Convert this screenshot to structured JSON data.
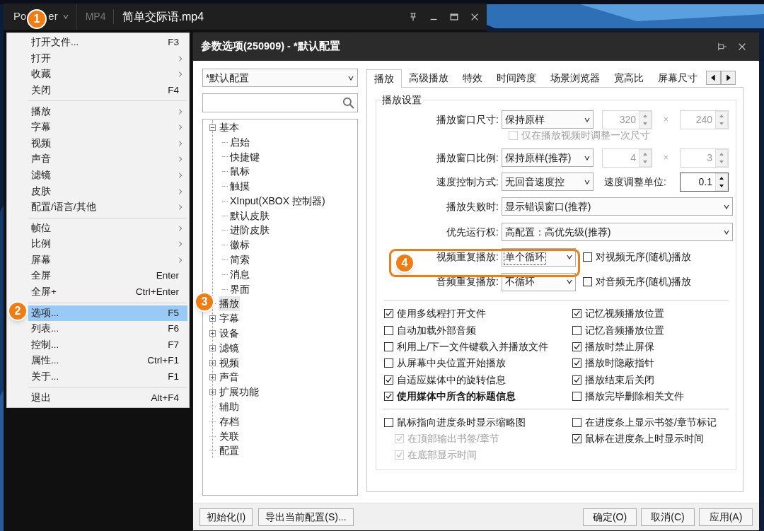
{
  "player": {
    "app_label_parts": [
      "Po",
      "er"
    ],
    "format": "MP4",
    "file": "简单交际语.mp4"
  },
  "badges": [
    "1",
    "2",
    "3",
    "4"
  ],
  "menu": {
    "groups": [
      [
        {
          "label": "打开文件...",
          "shortcut": "F3",
          "submenu": false,
          "selected": false
        },
        {
          "label": "打开",
          "submenu": true,
          "selected": false
        },
        {
          "label": "收藏",
          "submenu": true,
          "selected": false
        },
        {
          "label": "关闭",
          "shortcut": "F4",
          "submenu": false,
          "selected": false
        }
      ],
      [
        {
          "label": "播放",
          "submenu": true,
          "selected": false
        },
        {
          "label": "字幕",
          "submenu": true,
          "selected": false
        },
        {
          "label": "视频",
          "submenu": true,
          "selected": false
        },
        {
          "label": "声音",
          "submenu": true,
          "selected": false
        },
        {
          "label": "滤镜",
          "submenu": true,
          "selected": false
        },
        {
          "label": "皮肤",
          "submenu": true,
          "selected": false
        },
        {
          "label": "配置/语言/其他",
          "submenu": true,
          "selected": false
        }
      ],
      [
        {
          "label": "帧位",
          "submenu": true,
          "selected": false
        },
        {
          "label": "比例",
          "submenu": true,
          "selected": false
        },
        {
          "label": "屏幕",
          "submenu": true,
          "selected": false
        },
        {
          "label": "全屏",
          "shortcut": "Enter",
          "submenu": false,
          "selected": false
        },
        {
          "label": "全屏+",
          "shortcut": "Ctrl+Enter",
          "submenu": false,
          "selected": false
        }
      ],
      [
        {
          "label": "选项...",
          "shortcut": "F5",
          "submenu": false,
          "selected": true
        },
        {
          "label": "列表...",
          "shortcut": "F6",
          "submenu": false,
          "selected": false
        },
        {
          "label": "控制...",
          "shortcut": "F7",
          "submenu": false,
          "selected": false
        },
        {
          "label": "属性...",
          "shortcut": "Ctrl+F1",
          "submenu": false,
          "selected": false
        },
        {
          "label": "关于...",
          "shortcut": "F1",
          "submenu": false,
          "selected": false
        }
      ],
      [
        {
          "label": "退出",
          "shortcut": "Alt+F4",
          "submenu": false,
          "selected": false
        }
      ]
    ]
  },
  "dialog": {
    "title": "参数选项(250909) - *默认配置",
    "profile": "*默认配置",
    "tree": [
      {
        "label": "基本",
        "expanded": true,
        "selected": false,
        "children": [
          {
            "label": "启始",
            "selected": false
          },
          {
            "label": "快捷键",
            "selected": false
          },
          {
            "label": "鼠标",
            "selected": false
          },
          {
            "label": "触摸",
            "selected": false
          },
          {
            "label": "XInput(XBOX 控制器)",
            "selected": false
          },
          {
            "label": "默认皮肤",
            "selected": false
          },
          {
            "label": "进阶皮肤",
            "selected": false
          },
          {
            "label": "徽标",
            "selected": false
          },
          {
            "label": "简索",
            "selected": false
          },
          {
            "label": "消息",
            "selected": false
          },
          {
            "label": "界面",
            "selected": false
          }
        ]
      },
      {
        "label": "播放",
        "selected": true
      },
      {
        "label": "字幕",
        "expanded": false,
        "selected": false
      },
      {
        "label": "设备",
        "expanded": false,
        "selected": false
      },
      {
        "label": "滤镜",
        "expanded": false,
        "selected": false
      },
      {
        "label": "视频",
        "expanded": false,
        "selected": false
      },
      {
        "label": "声音",
        "expanded": false,
        "selected": false
      },
      {
        "label": "扩展功能",
        "expanded": false,
        "selected": false
      },
      {
        "label": "辅助",
        "selected": false
      },
      {
        "label": "存档",
        "selected": false
      },
      {
        "label": "关联",
        "selected": false
      },
      {
        "label": "配置",
        "selected": false
      }
    ],
    "tabs": [
      {
        "label": "播放",
        "selected": true
      },
      {
        "label": "高级播放",
        "selected": false
      },
      {
        "label": "特效",
        "selected": false
      },
      {
        "label": "时间跨度",
        "selected": false
      },
      {
        "label": "场景浏览器",
        "selected": false
      },
      {
        "label": "宽高比",
        "selected": false
      },
      {
        "label": "屏幕尺寸",
        "selected": false
      }
    ],
    "group_title": "播放设置",
    "rows": [
      {
        "kind": "select_pair",
        "label": "播放窗口尺寸:",
        "value": "保持原样",
        "a": "320",
        "sep": "×",
        "b": "240",
        "disabled": true
      },
      {
        "kind": "checkbox",
        "label": "仅在播放视频时调整一次尺寸",
        "checked": false,
        "disabled": true
      },
      {
        "kind": "select_pair",
        "label": "播放窗口比例:",
        "value": "保持原样(推荐)",
        "a": "4",
        "sep": "×",
        "b": "3",
        "disabled": true
      },
      {
        "kind": "select_spin",
        "label": "速度控制方式:",
        "value": "无回音速度控",
        "label2": "速度调整单位:",
        "spin": "0.1"
      },
      {
        "kind": "select_wide",
        "label": "播放失败时:",
        "value": "显示错误窗口(推荐)"
      },
      {
        "kind": "select_wide",
        "label": "优先运行权:",
        "value": "高配置：高优先级(推荐)"
      },
      {
        "kind": "select_check",
        "label": "视频重复播放:",
        "value": "单个循环",
        "focused": true,
        "check": {
          "label": "对视频无序(随机)播放",
          "checked": false
        }
      },
      {
        "kind": "select_check",
        "label": "音频重复播放:",
        "value": "不循环",
        "focused": false,
        "check": {
          "label": "对音频无序(随机)播放",
          "checked": false
        }
      }
    ],
    "options": [
      {
        "label": "使用多线程打开文件",
        "checked": true,
        "bold": false
      },
      {
        "label": "记忆视频播放位置",
        "checked": true,
        "bold": false
      },
      {
        "label": "自动加载外部音频",
        "checked": false,
        "bold": false
      },
      {
        "label": "记忆音频播放位置",
        "checked": false,
        "bold": false
      },
      {
        "label": "利用上/下一文件键载入并播放文件",
        "checked": false,
        "bold": false
      },
      {
        "label": "播放时禁止屏保",
        "checked": true,
        "bold": false
      },
      {
        "label": "从屏幕中央位置开始播放",
        "checked": false,
        "bold": false
      },
      {
        "label": "播放时隐蔽指针",
        "checked": true,
        "bold": false
      },
      {
        "label": "自适应媒体中的旋转信息",
        "checked": true,
        "bold": false
      },
      {
        "label": "播放结束后关闭",
        "checked": true,
        "bold": false
      },
      {
        "label": "使用媒体中所含的标题信息",
        "checked": true,
        "bold": true
      },
      {
        "label": "播放完毕删除相关文件",
        "checked": false,
        "bold": false
      }
    ],
    "options2": {
      "left": [
        {
          "label": "鼠标指向进度条时显示缩略图",
          "checked": false,
          "disabled": false,
          "children": [
            {
              "label": "在顶部输出书签/章节",
              "checked": true,
              "disabled": true
            },
            {
              "label": "在底部显示时间",
              "checked": true,
              "disabled": true
            }
          ]
        }
      ],
      "right": [
        {
          "label": "在进度条上显示书签/章节标记",
          "checked": false,
          "disabled": false
        },
        {
          "label": "鼠标在进度条上时显示时间",
          "checked": true,
          "disabled": false
        }
      ]
    },
    "buttons_left": [
      "初始化(I)",
      "导出当前配置(S)..."
    ],
    "buttons_right": [
      "确定(O)",
      "取消(C)",
      "应用(A)"
    ]
  }
}
